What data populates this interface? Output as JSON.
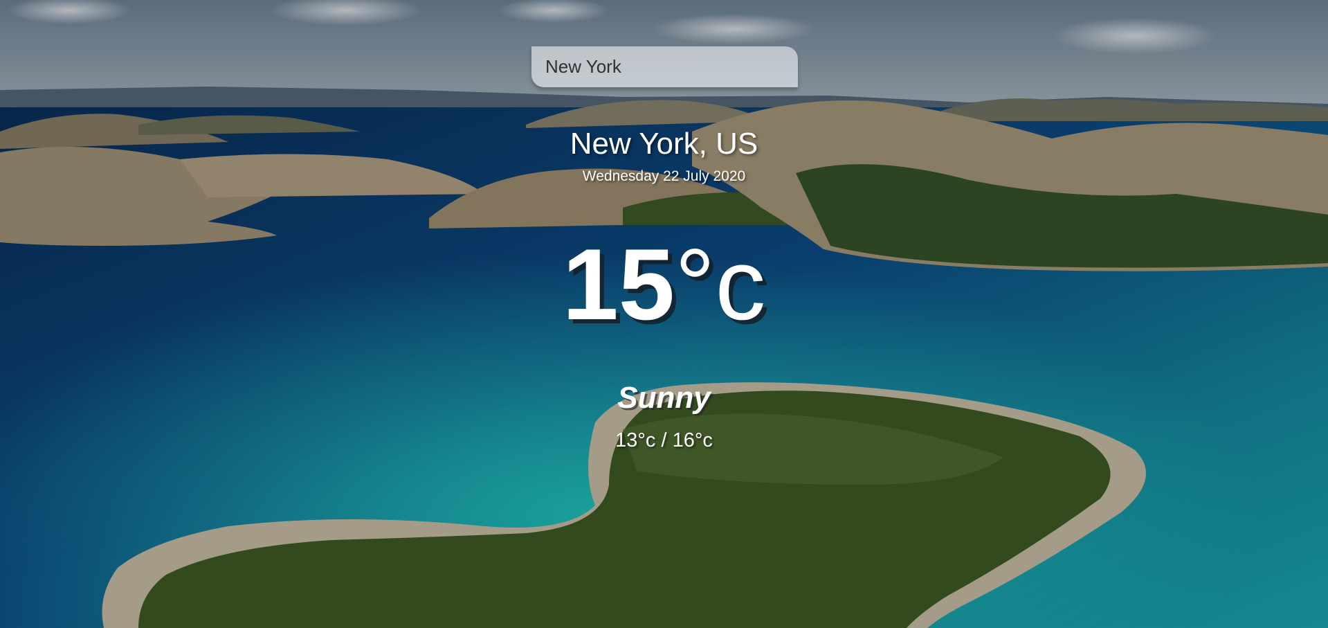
{
  "search": {
    "value": "New York",
    "placeholder": ""
  },
  "location": {
    "city_country": "New York, US",
    "date": "Wednesday 22 July 2020"
  },
  "current": {
    "temperature": "15",
    "unit": "°c",
    "condition": "Sunny",
    "hi_low": "13°c / 16°c"
  },
  "colors": {
    "sea_deep": "#0b3f73",
    "sea_turquoise": "#1aa9b4",
    "sky": "#8fa3b3",
    "text": "#ffffff"
  }
}
